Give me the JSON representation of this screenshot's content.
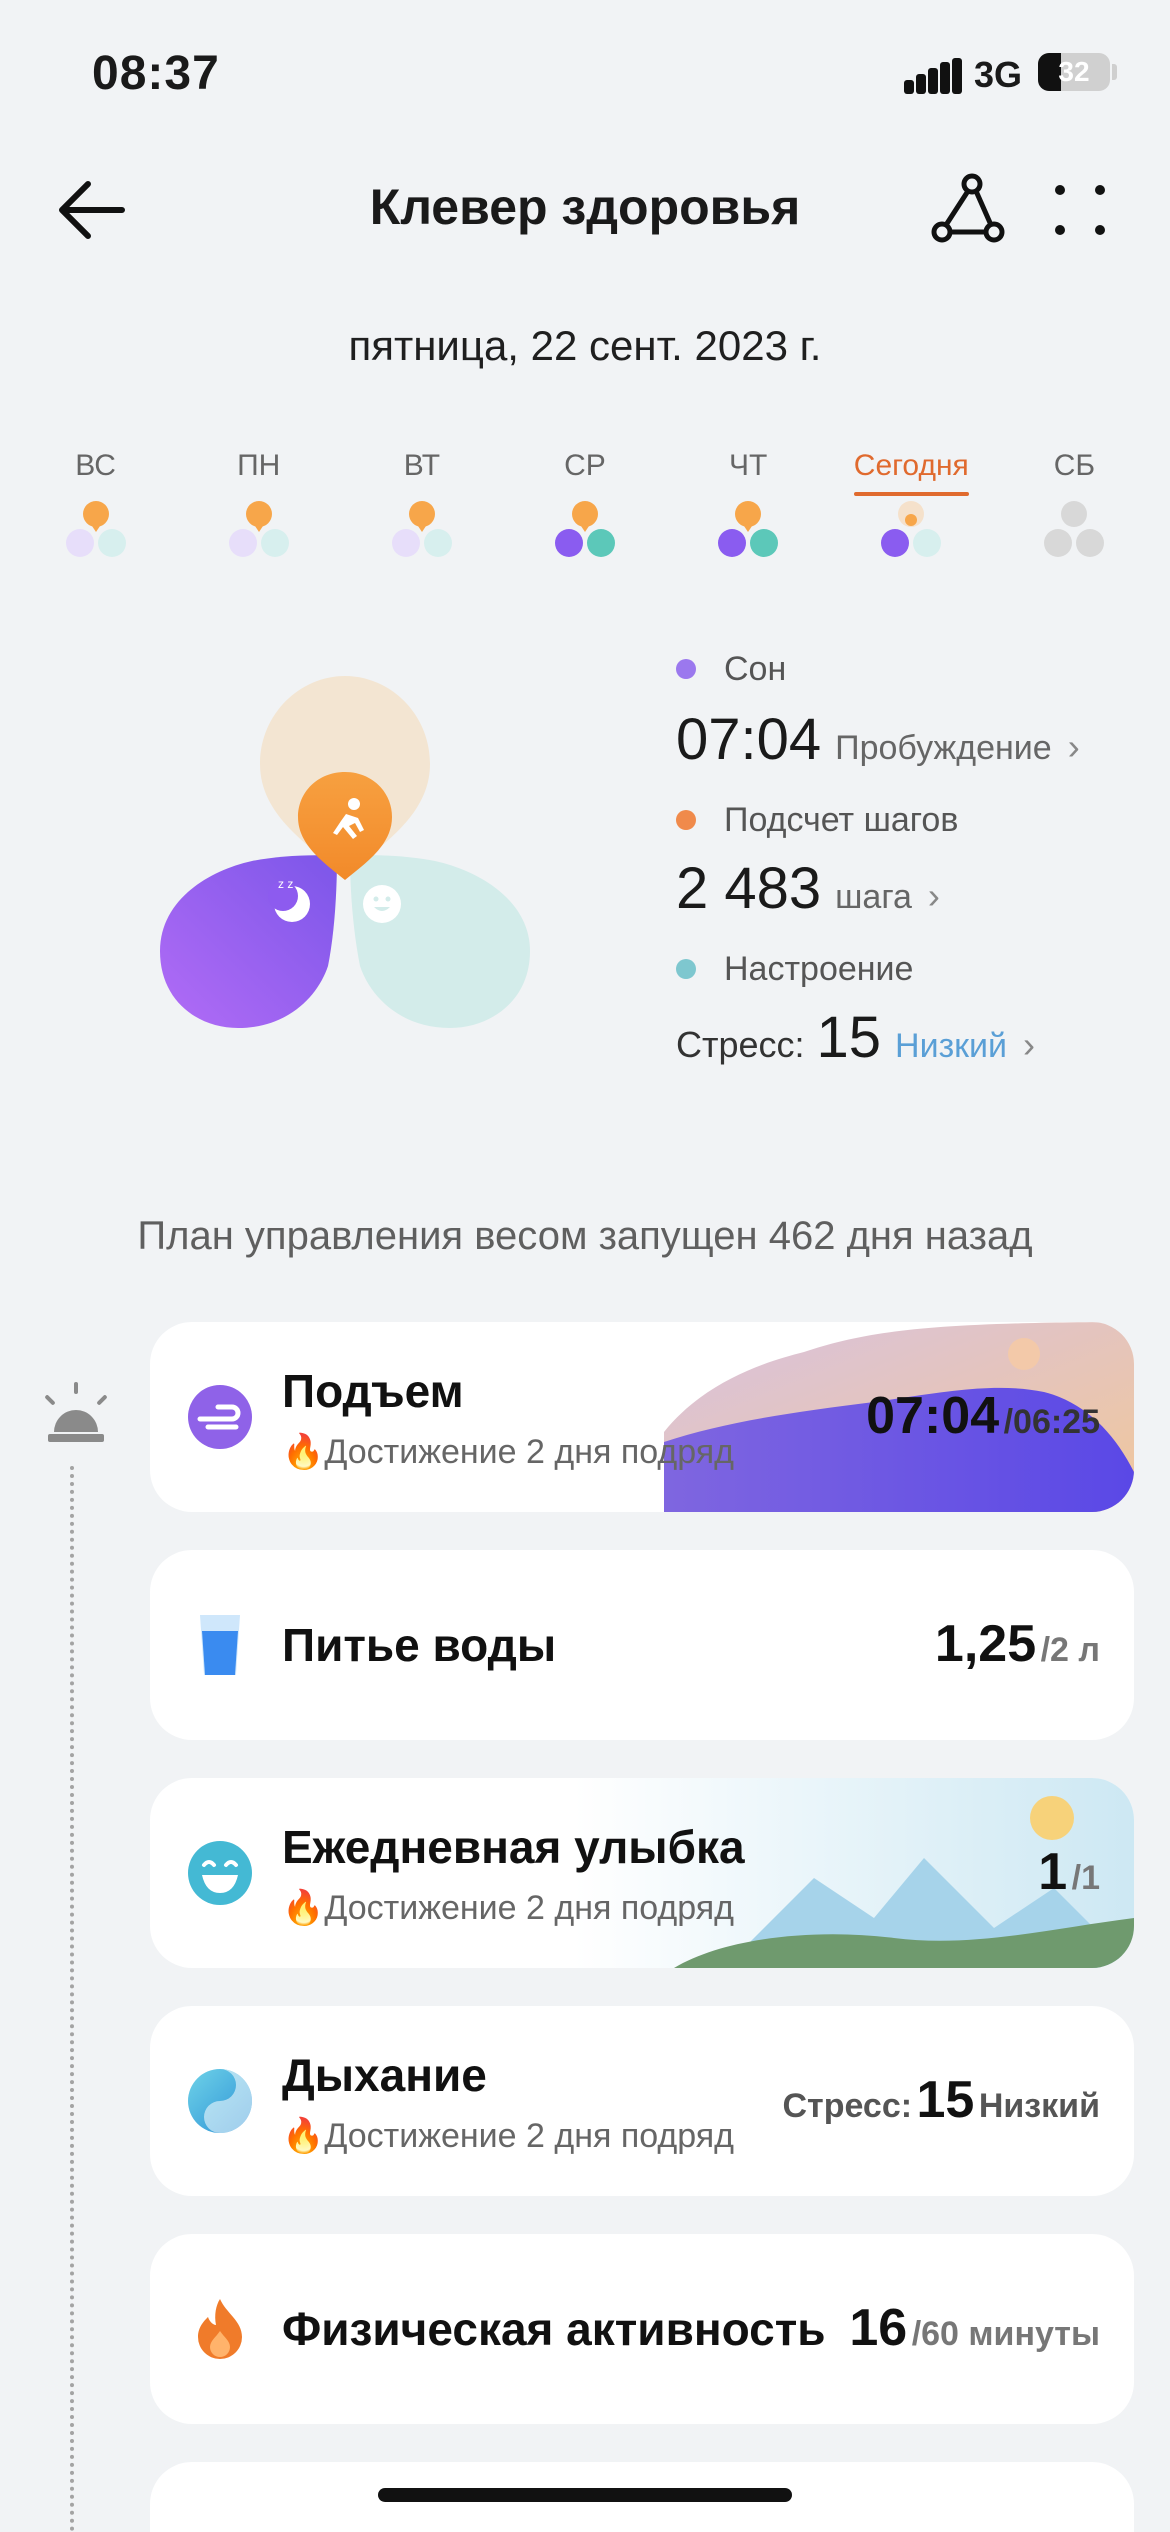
{
  "status": {
    "time": "08:37",
    "network": "3G",
    "battery": "32",
    "battery_level": 0.32
  },
  "header": {
    "title": "Клевер здоровья",
    "back_icon": "arrow-left-icon",
    "share_icon": "share-icon",
    "more_icon": "more-icon"
  },
  "date": "пятница, 22 сент. 2023 г.",
  "week": [
    {
      "label": "ВС",
      "active": false
    },
    {
      "label": "ПН",
      "active": false
    },
    {
      "label": "ВТ",
      "active": false
    },
    {
      "label": "СР",
      "active": true
    },
    {
      "label": "ЧТ",
      "active": true
    },
    {
      "label": "Сегодня",
      "active": true,
      "today": true
    },
    {
      "label": "СБ",
      "active": false,
      "future": true
    }
  ],
  "metrics": {
    "sleep": {
      "label": "Сон",
      "value": "07:04",
      "sub": "Пробуждение",
      "color": "#9b78ee"
    },
    "steps": {
      "label": "Подсчет шагов",
      "value": "2 483",
      "sub": "шага",
      "color": "#f08a4b"
    },
    "mood": {
      "label": "Настроение",
      "prefix": "Стресс:",
      "value": "15",
      "sub": "Низкий",
      "color": "#7ec7cf"
    }
  },
  "plan": "План управления весом запущен 462 дня назад",
  "cards": [
    {
      "title": "Подъем",
      "achievement": "Достижение 2 дня подряд",
      "value": "07:04",
      "target": "/06:25"
    },
    {
      "title": "Питье воды",
      "value": "1,25",
      "target": "/2 л"
    },
    {
      "title": "Ежедневная улыбка",
      "achievement": "Достижение 2 дня подряд",
      "value": "1",
      "target": "/1"
    },
    {
      "title": "Дыхание",
      "achievement": "Достижение 2 дня подряд",
      "prefix": "Стресс:",
      "value": "15",
      "target": "Низкий"
    },
    {
      "title": "Физическая активность",
      "value": "16",
      "target": "/60 минуты"
    }
  ],
  "fire_glyph": "🔥",
  "colors": {
    "accent": "#e06a2e",
    "sleep": "#9b78ee",
    "steps": "#f08a4b",
    "mood": "#7ec7cf"
  }
}
